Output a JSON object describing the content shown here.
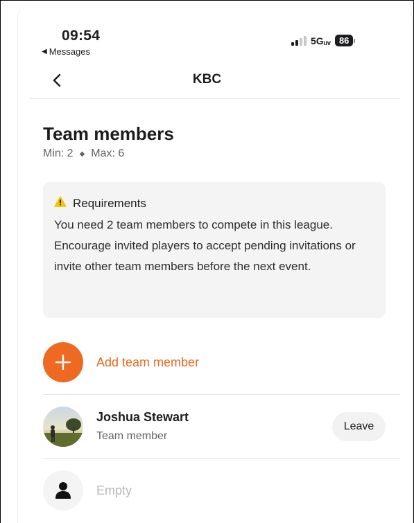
{
  "status_bar": {
    "time": "09:54",
    "back_app": "Messages",
    "network": "5Gᵤᵥ",
    "battery": "86"
  },
  "nav": {
    "back_icon": "chevron-left-icon",
    "title": "KBC"
  },
  "team": {
    "title": "Team members",
    "min_label": "Min: 2",
    "max_label": "Max: 6"
  },
  "requirements": {
    "title": "Requirements",
    "icon": "warning-icon",
    "body": "You need 2 team members to compete in this league. Encourage invited players to accept pending invitations or invite other team members before the next event."
  },
  "add_member": {
    "label": "Add team member",
    "icon": "plus-icon"
  },
  "members": [
    {
      "name": "Joshua Stewart",
      "role": "Team member",
      "action": "Leave"
    }
  ],
  "empty_slot": {
    "label": "Empty",
    "icon": "person-icon"
  },
  "colors": {
    "accent": "#ee6a22",
    "warning": "#f5c400",
    "card_bg": "#f4f4f5"
  }
}
